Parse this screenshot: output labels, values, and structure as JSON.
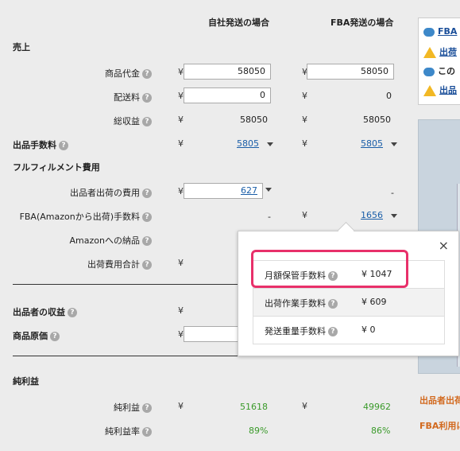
{
  "headers": {
    "self": "自社発送の場合",
    "fba": "FBA発送の場合"
  },
  "sections": {
    "sales": "売上",
    "seller_fee": "出品手数料",
    "fulfillment": "フルフィルメント費用",
    "seller_revenue": "出品者の収益",
    "cost": "商品原価",
    "net_profit": "純利益"
  },
  "rows": {
    "item_price": {
      "label": "商品代金",
      "self": "58050",
      "fba": "58050"
    },
    "shipping": {
      "label": "配送料",
      "self": "0",
      "fba": "0"
    },
    "total_revenue": {
      "label": "総収益",
      "self": "58050",
      "fba": "58050"
    },
    "seller_fee": {
      "self": "5805",
      "fba": "5805"
    },
    "seller_ship_cost": {
      "label": "出品者出荷の費用",
      "self": "627",
      "fba": "-"
    },
    "fba_fee": {
      "label": "FBA(Amazonから出荷)手数料",
      "self": "-",
      "fba": "1656"
    },
    "amazon_inbound": {
      "label": "Amazonへの納品"
    },
    "ship_total": {
      "label": "出荷費用合計"
    },
    "net_profit": {
      "label": "純利益",
      "self": "51618",
      "fba": "49962"
    },
    "net_margin": {
      "label": "純利益率",
      "self": "89%",
      "fba": "86%"
    }
  },
  "currency": "¥",
  "popup": {
    "close": "×",
    "items": [
      {
        "label": "月額保管手数料",
        "value": "¥ 1047"
      },
      {
        "label": "出荷作業手数料",
        "value": "¥ 609"
      },
      {
        "label": "発送重量手数料",
        "value": "¥ 0"
      }
    ]
  },
  "right_panel": {
    "items": [
      {
        "icon": "speech-bubble-icon",
        "text": "FBA"
      },
      {
        "icon": "warning-icon",
        "text": "出荷"
      },
      {
        "icon": "speech-bubble-icon",
        "text": "この"
      },
      {
        "icon": "warning-icon",
        "text": "出品"
      }
    ],
    "notes": [
      "出品者出荷",
      "FBA利用に"
    ]
  },
  "help_glyph": "?"
}
